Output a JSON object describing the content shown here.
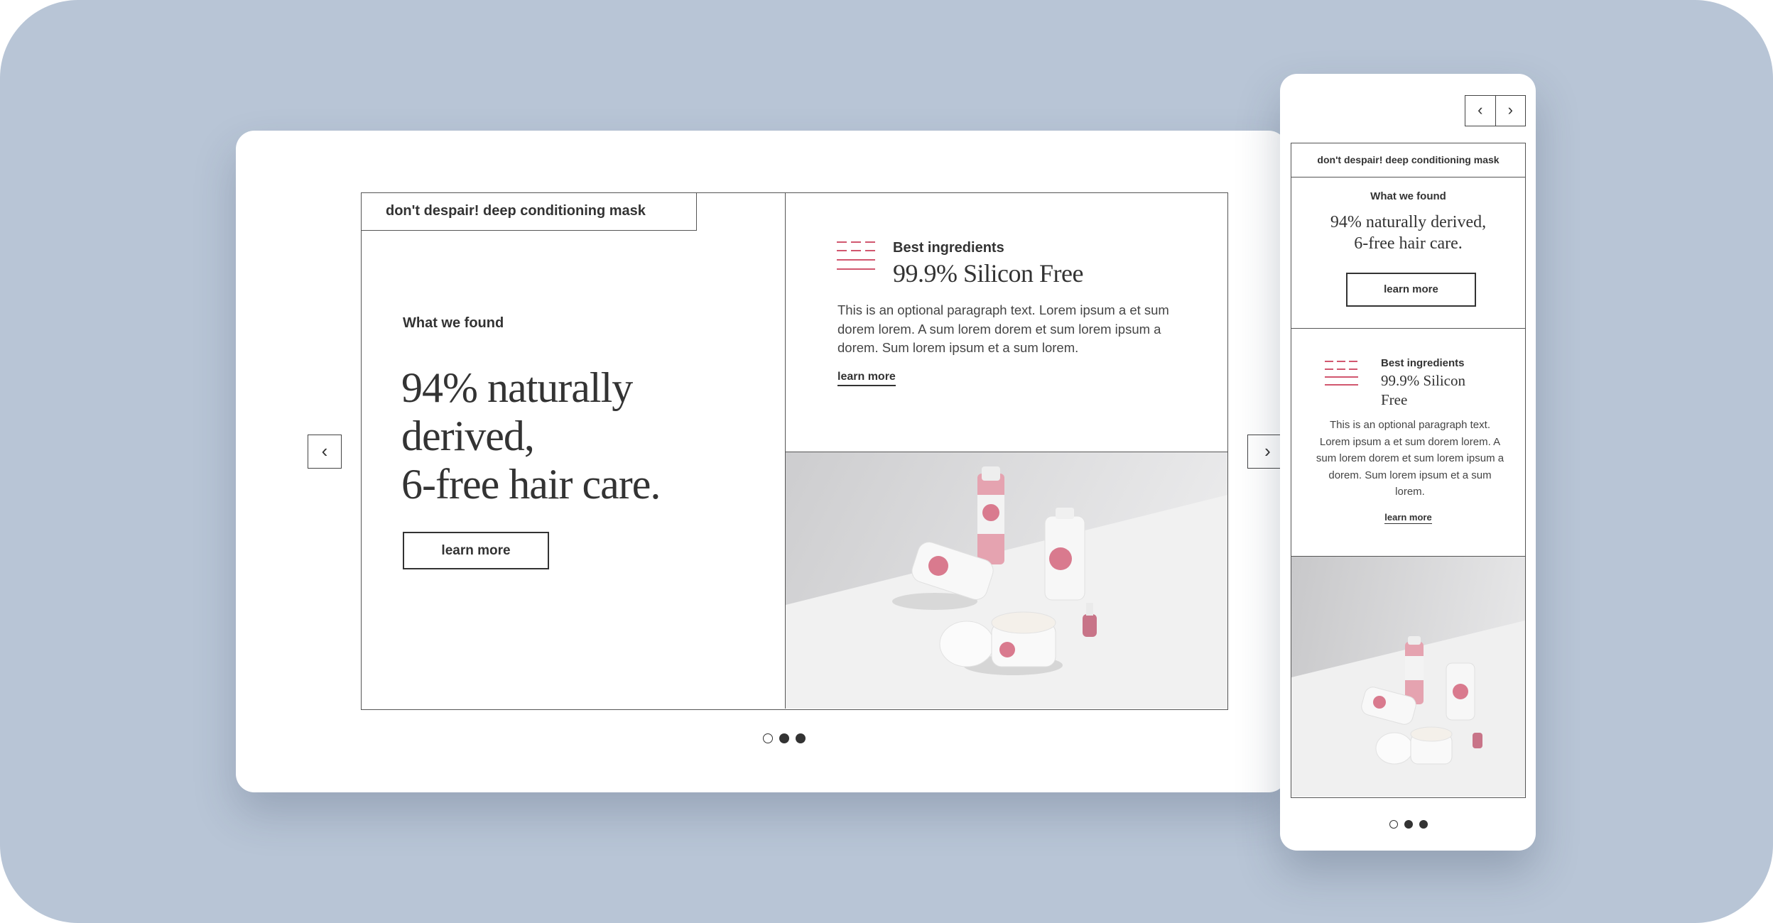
{
  "desktop": {
    "product_tag": "don't despair! deep conditioning mask",
    "eyebrow": "What we found",
    "headline_line1": "94% naturally",
    "headline_line2": "derived,",
    "headline_line3": "6-free hair care.",
    "cta_label": "learn more",
    "ingredient_label": "Best ingredients",
    "ingredient_title": "99.9% Silicon Free",
    "paragraph": "This is an optional paragraph text. Lorem ipsum a et sum dorem lorem. A sum lorem dorem et sum lorem ipsum a dorem. Sum lorem ipsum et a sum lorem.",
    "learn_more_link": "learn more",
    "prev_icon": "chevron-left-icon",
    "next_icon": "chevron-right-icon",
    "prev_glyph": "‹",
    "next_glyph": "›",
    "pagination": {
      "total": 3,
      "active": 1
    }
  },
  "mobile": {
    "product_tag": "don't despair! deep conditioning mask",
    "eyebrow": "What we found",
    "headline_line1": "94% naturally derived,",
    "headline_line2": "6-free hair care.",
    "cta_label": "learn more",
    "ingredient_label": "Best ingredients",
    "ingredient_title": "99.9% Silicon Free",
    "paragraph": "This is an optional paragraph text. Lorem ipsum a et sum dorem lorem. A sum lorem dorem et sum lorem ipsum a dorem. Sum lorem ipsum et a sum lorem.",
    "learn_more_link": "learn more",
    "prev_glyph": "‹",
    "next_glyph": "›",
    "pagination": {
      "total": 3,
      "active": 1
    }
  },
  "colors": {
    "background": "#b8c5d6",
    "accent": "#d1576f",
    "text": "#333333"
  }
}
